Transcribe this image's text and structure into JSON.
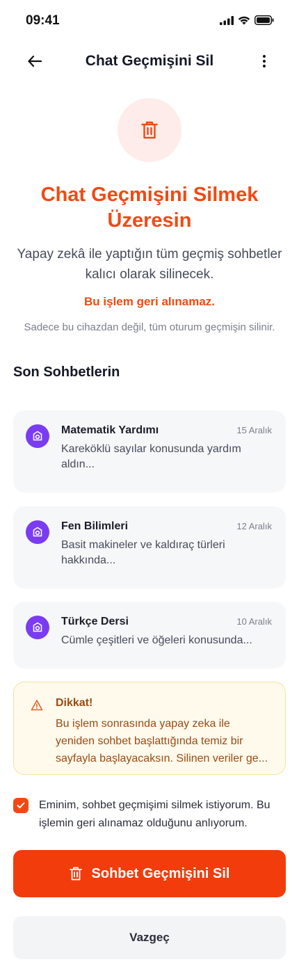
{
  "status_bar": {
    "time": "09:41"
  },
  "header": {
    "title": "Chat Geçmişini Sil"
  },
  "hero": {
    "title_line1": "Chat Geçmişini Silmek",
    "title_line2": "Üzeresin",
    "desc_line1": "Yapay zekâ ile yaptığın tüm geçmiş sohbetler",
    "desc_line2": "kalıcı olarak silinecek.",
    "warning": "Bu işlem geri alınamaz.",
    "note": "Sadece bu cihazdan değil, tüm oturum geçmişin silinir."
  },
  "recent": {
    "title": "Son Sohbetlerin",
    "items": [
      {
        "title": "Matematik Yardımı",
        "date": "15 Aralık",
        "preview_line1": "Kareköklü sayılar konusunda yardım",
        "preview_line2": "aldın..."
      },
      {
        "title": "Fen Bilimleri",
        "date": "12 Aralık",
        "preview_line1": "Basit makineler ve kaldıraç türleri",
        "preview_line2": "hakkında..."
      },
      {
        "title": "Türkçe Dersi",
        "date": "10 Aralık",
        "preview_line1": "Cümle çeşitleri ve öğeleri konusunda...",
        "preview_line2": ""
      }
    ]
  },
  "alert": {
    "title": "Dikkat!",
    "line1": "Bu işlem sonrasında yapay zeka ile",
    "line2": "yeniden sohbet başlattığında temiz bir",
    "line3": "sayfayla başlayacaksın. Silinen veriler ge..."
  },
  "confirm": {
    "checked": true,
    "line1": "Eminim, sohbet geçmişimi silmek istiyorum. Bu",
    "line2": "işlemin geri alınamaz olduğunu anlıyorum."
  },
  "actions": {
    "delete_label": "Sohbet Geçmişini Sil",
    "cancel_label": "Vazgeç"
  },
  "colors": {
    "accent": "#f23c0c",
    "avatar": "#7a3cf0",
    "alert_bg": "#fffaec",
    "alert_text": "#9a4a14"
  },
  "icons": {
    "back": "arrow-left-icon",
    "more": "more-vertical-icon",
    "hero": "trash-icon",
    "avatar": "ai-bot-icon",
    "alert": "warning-triangle-icon",
    "check": "check-icon"
  }
}
